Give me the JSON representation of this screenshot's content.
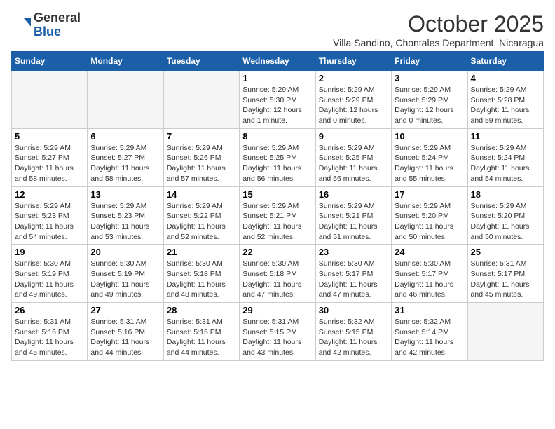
{
  "header": {
    "logo_general": "General",
    "logo_blue": "Blue",
    "month_title": "October 2025",
    "subtitle": "Villa Sandino, Chontales Department, Nicaragua"
  },
  "days_of_week": [
    "Sunday",
    "Monday",
    "Tuesday",
    "Wednesday",
    "Thursday",
    "Friday",
    "Saturday"
  ],
  "weeks": [
    [
      {
        "day": "",
        "info": ""
      },
      {
        "day": "",
        "info": ""
      },
      {
        "day": "",
        "info": ""
      },
      {
        "day": "1",
        "info": "Sunrise: 5:29 AM\nSunset: 5:30 PM\nDaylight: 12 hours\nand 1 minute."
      },
      {
        "day": "2",
        "info": "Sunrise: 5:29 AM\nSunset: 5:29 PM\nDaylight: 12 hours\nand 0 minutes."
      },
      {
        "day": "3",
        "info": "Sunrise: 5:29 AM\nSunset: 5:29 PM\nDaylight: 12 hours\nand 0 minutes."
      },
      {
        "day": "4",
        "info": "Sunrise: 5:29 AM\nSunset: 5:28 PM\nDaylight: 11 hours\nand 59 minutes."
      }
    ],
    [
      {
        "day": "5",
        "info": "Sunrise: 5:29 AM\nSunset: 5:27 PM\nDaylight: 11 hours\nand 58 minutes."
      },
      {
        "day": "6",
        "info": "Sunrise: 5:29 AM\nSunset: 5:27 PM\nDaylight: 11 hours\nand 58 minutes."
      },
      {
        "day": "7",
        "info": "Sunrise: 5:29 AM\nSunset: 5:26 PM\nDaylight: 11 hours\nand 57 minutes."
      },
      {
        "day": "8",
        "info": "Sunrise: 5:29 AM\nSunset: 5:25 PM\nDaylight: 11 hours\nand 56 minutes."
      },
      {
        "day": "9",
        "info": "Sunrise: 5:29 AM\nSunset: 5:25 PM\nDaylight: 11 hours\nand 56 minutes."
      },
      {
        "day": "10",
        "info": "Sunrise: 5:29 AM\nSunset: 5:24 PM\nDaylight: 11 hours\nand 55 minutes."
      },
      {
        "day": "11",
        "info": "Sunrise: 5:29 AM\nSunset: 5:24 PM\nDaylight: 11 hours\nand 54 minutes."
      }
    ],
    [
      {
        "day": "12",
        "info": "Sunrise: 5:29 AM\nSunset: 5:23 PM\nDaylight: 11 hours\nand 54 minutes."
      },
      {
        "day": "13",
        "info": "Sunrise: 5:29 AM\nSunset: 5:23 PM\nDaylight: 11 hours\nand 53 minutes."
      },
      {
        "day": "14",
        "info": "Sunrise: 5:29 AM\nSunset: 5:22 PM\nDaylight: 11 hours\nand 52 minutes."
      },
      {
        "day": "15",
        "info": "Sunrise: 5:29 AM\nSunset: 5:21 PM\nDaylight: 11 hours\nand 52 minutes."
      },
      {
        "day": "16",
        "info": "Sunrise: 5:29 AM\nSunset: 5:21 PM\nDaylight: 11 hours\nand 51 minutes."
      },
      {
        "day": "17",
        "info": "Sunrise: 5:29 AM\nSunset: 5:20 PM\nDaylight: 11 hours\nand 50 minutes."
      },
      {
        "day": "18",
        "info": "Sunrise: 5:29 AM\nSunset: 5:20 PM\nDaylight: 11 hours\nand 50 minutes."
      }
    ],
    [
      {
        "day": "19",
        "info": "Sunrise: 5:30 AM\nSunset: 5:19 PM\nDaylight: 11 hours\nand 49 minutes."
      },
      {
        "day": "20",
        "info": "Sunrise: 5:30 AM\nSunset: 5:19 PM\nDaylight: 11 hours\nand 49 minutes."
      },
      {
        "day": "21",
        "info": "Sunrise: 5:30 AM\nSunset: 5:18 PM\nDaylight: 11 hours\nand 48 minutes."
      },
      {
        "day": "22",
        "info": "Sunrise: 5:30 AM\nSunset: 5:18 PM\nDaylight: 11 hours\nand 47 minutes."
      },
      {
        "day": "23",
        "info": "Sunrise: 5:30 AM\nSunset: 5:17 PM\nDaylight: 11 hours\nand 47 minutes."
      },
      {
        "day": "24",
        "info": "Sunrise: 5:30 AM\nSunset: 5:17 PM\nDaylight: 11 hours\nand 46 minutes."
      },
      {
        "day": "25",
        "info": "Sunrise: 5:31 AM\nSunset: 5:17 PM\nDaylight: 11 hours\nand 45 minutes."
      }
    ],
    [
      {
        "day": "26",
        "info": "Sunrise: 5:31 AM\nSunset: 5:16 PM\nDaylight: 11 hours\nand 45 minutes."
      },
      {
        "day": "27",
        "info": "Sunrise: 5:31 AM\nSunset: 5:16 PM\nDaylight: 11 hours\nand 44 minutes."
      },
      {
        "day": "28",
        "info": "Sunrise: 5:31 AM\nSunset: 5:15 PM\nDaylight: 11 hours\nand 44 minutes."
      },
      {
        "day": "29",
        "info": "Sunrise: 5:31 AM\nSunset: 5:15 PM\nDaylight: 11 hours\nand 43 minutes."
      },
      {
        "day": "30",
        "info": "Sunrise: 5:32 AM\nSunset: 5:15 PM\nDaylight: 11 hours\nand 42 minutes."
      },
      {
        "day": "31",
        "info": "Sunrise: 5:32 AM\nSunset: 5:14 PM\nDaylight: 11 hours\nand 42 minutes."
      },
      {
        "day": "",
        "info": ""
      }
    ]
  ]
}
